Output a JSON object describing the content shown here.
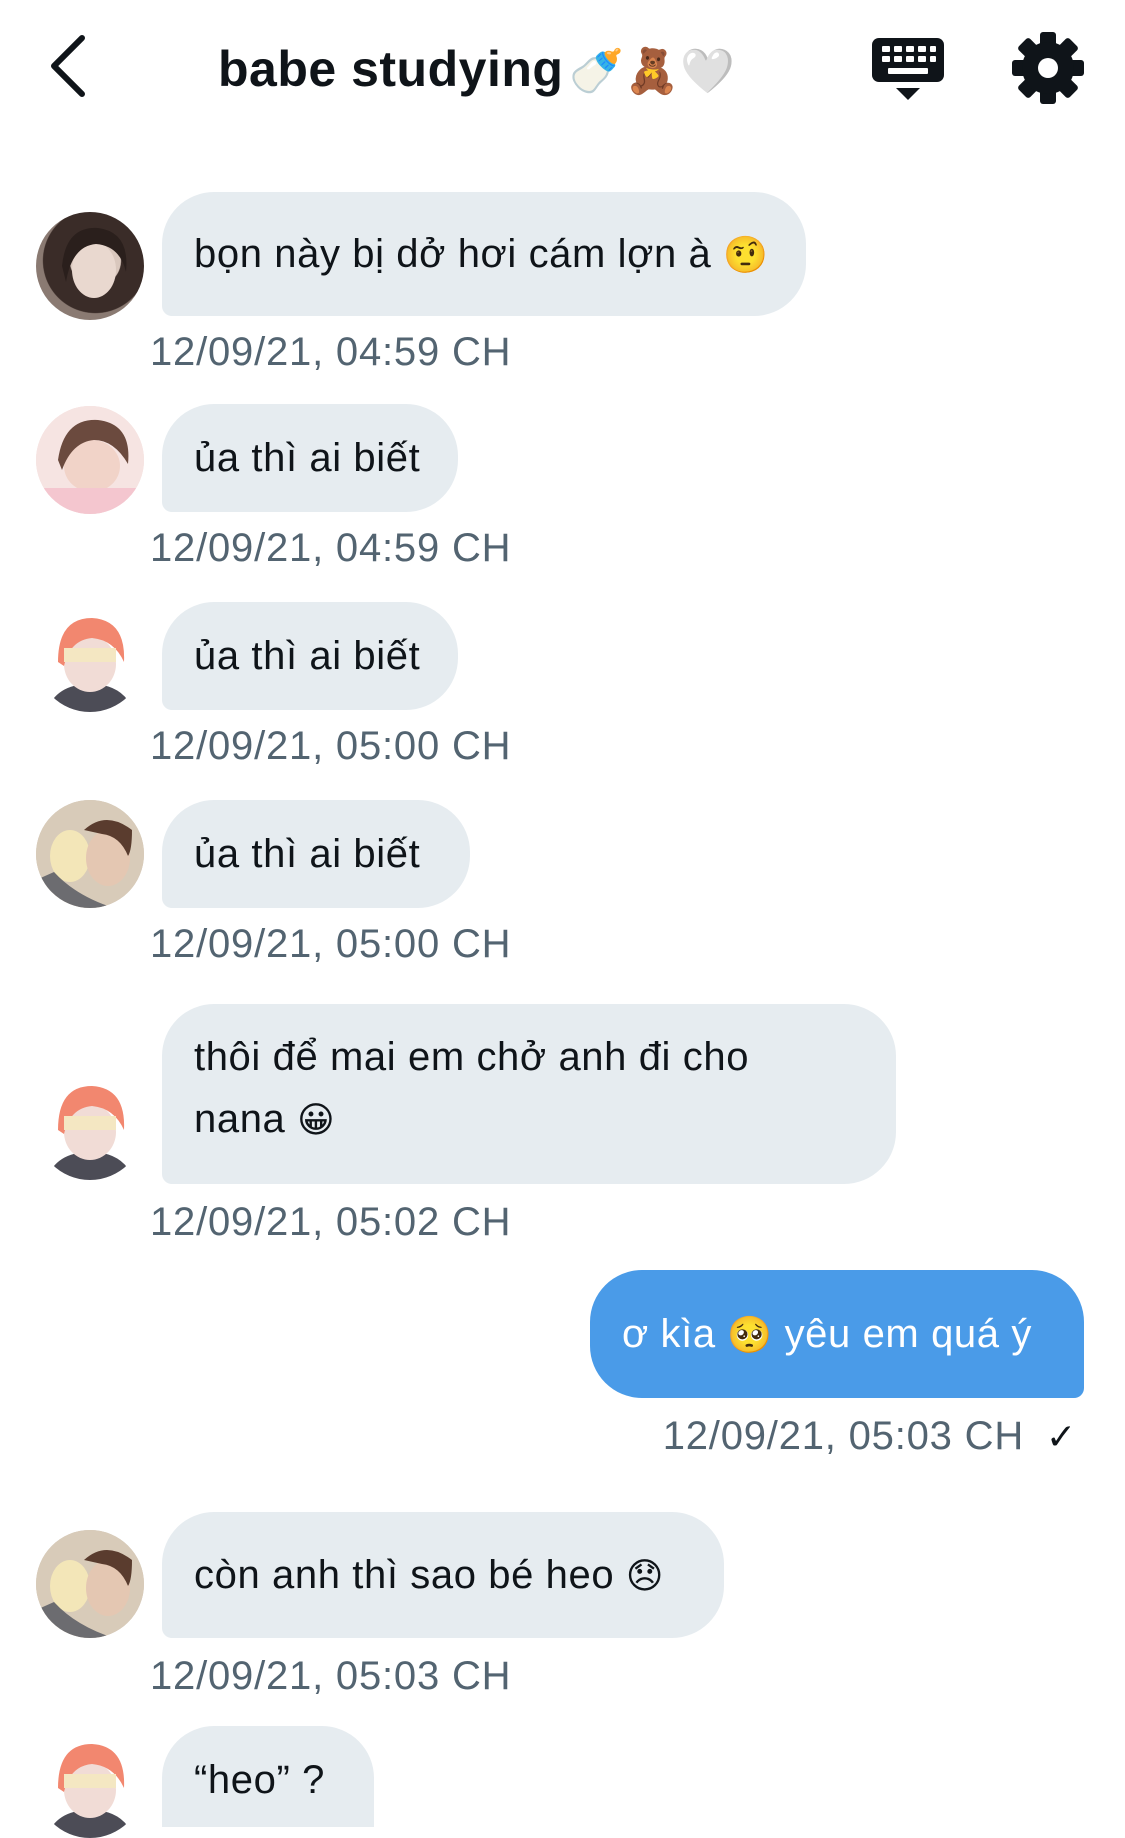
{
  "header": {
    "title": "babe studying",
    "title_emoji": "🍼🧸🤍",
    "back_icon": "chevron-left-icon",
    "keyboard_icon": "keyboard-icon",
    "settings_icon": "gear-icon"
  },
  "messages": [
    {
      "text": "bọn này bị dở hơi cám lợn à",
      "emoji": "🤨",
      "time": "12/09/21, 04:59 CH",
      "avatar": "avatar-1"
    },
    {
      "text": "ủa thì ai biết",
      "emoji": "",
      "time": "12/09/21, 04:59 CH",
      "avatar": "avatar-2"
    },
    {
      "text": "ủa thì ai biết",
      "emoji": "",
      "time": "12/09/21, 05:00 CH",
      "avatar": "avatar-3"
    },
    {
      "text": "ủa thì ai biết",
      "emoji": "",
      "time": "12/09/21, 05:00 CH",
      "avatar": "avatar-4"
    },
    {
      "text_line1": "thôi để mai em chở anh đi cho",
      "text_line2": "nana",
      "emoji": "😀",
      "time": "12/09/21, 05:02 CH",
      "avatar": "avatar-3"
    },
    {
      "text_a": "ơ kìa",
      "emoji": "🥺",
      "text_b": "yêu em quá ý",
      "time": "12/09/21, 05:03 CH",
      "status": "✓",
      "sent": true
    },
    {
      "text": "còn anh thì sao bé heo",
      "emoji": "😞",
      "time": "12/09/21, 05:03 CH",
      "avatar": "avatar-4"
    },
    {
      "text": "“heo” ?",
      "avatar": "avatar-3"
    }
  ],
  "colors": {
    "received_bubble": "#e6ecf0",
    "sent_bubble": "#4a9be8",
    "timestamp": "#536471",
    "text": "#0f1419"
  }
}
